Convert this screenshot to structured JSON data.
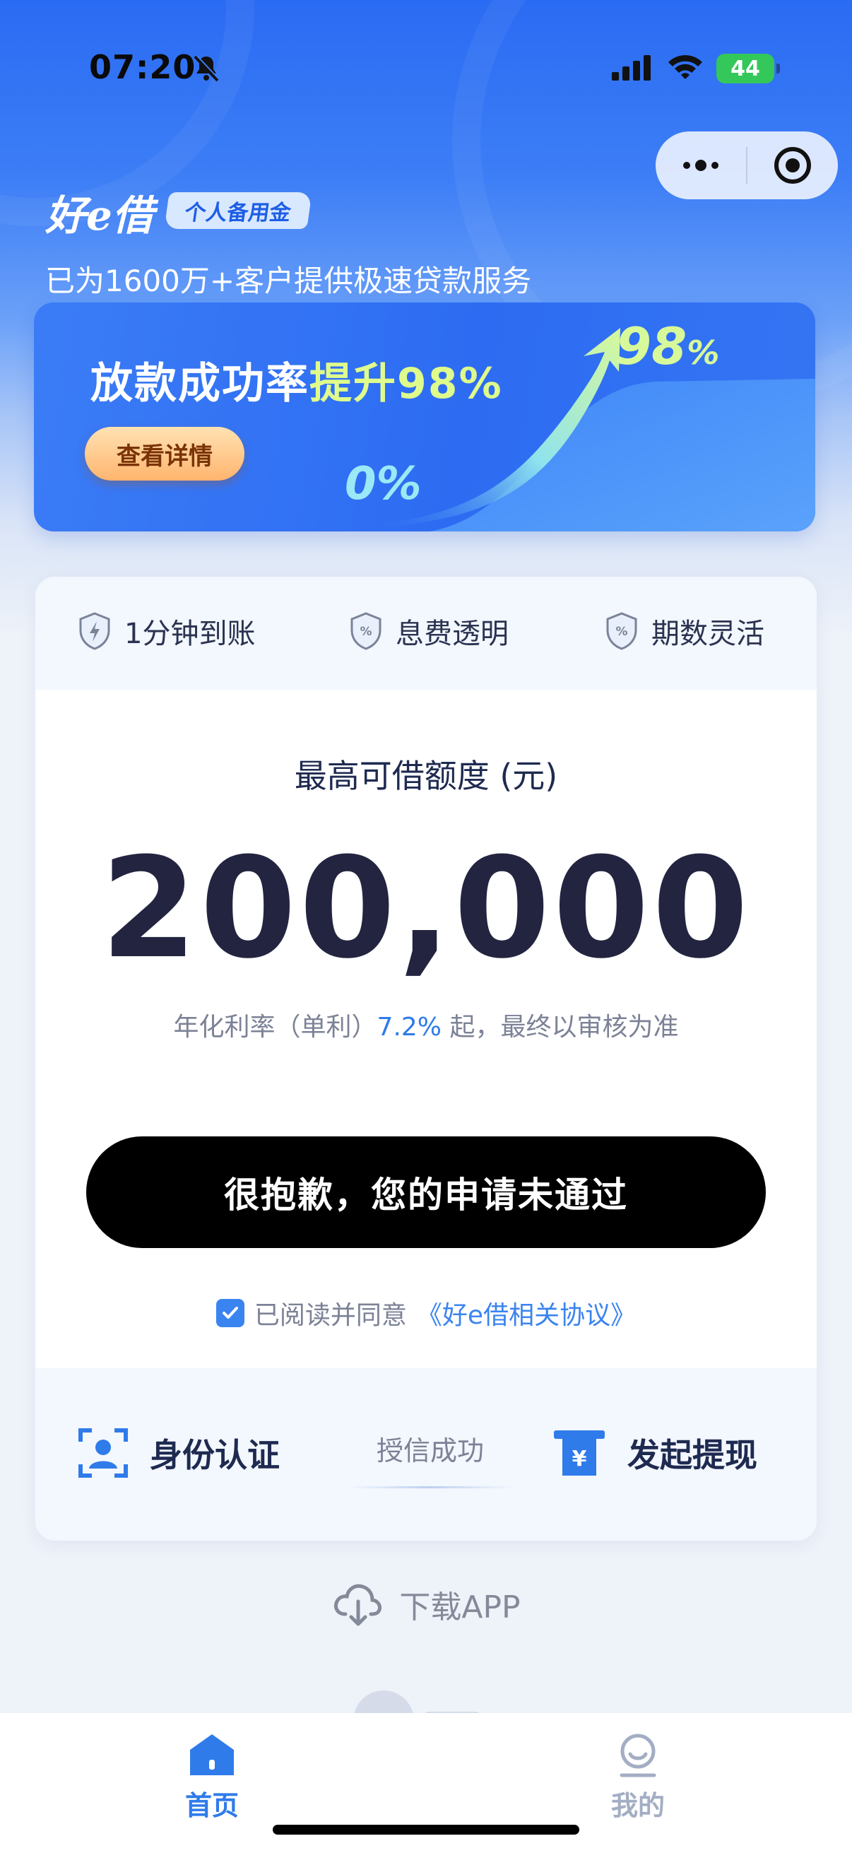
{
  "status_bar": {
    "time": "07:20",
    "battery": "44"
  },
  "header": {
    "logo": "好e借",
    "logo_tag": "个人备用金",
    "tagline": "已为1600万+客户提供极速贷款服务"
  },
  "banner": {
    "headline_prefix": "放款成功率",
    "headline_highlight": "提升98%",
    "button_label": "查看详情",
    "start_value": "0%",
    "end_value": "98",
    "end_unit": "%"
  },
  "features": [
    {
      "label": "1分钟到账",
      "icon": "shield-bolt-icon"
    },
    {
      "label": "息费透明",
      "icon": "shield-percent-icon"
    },
    {
      "label": "期数灵活",
      "icon": "shield-percent-icon"
    }
  ],
  "loan": {
    "title": "最高可借额度 (元)",
    "amount": "200,000",
    "rate_prefix": "年化利率（单利）",
    "rate": "7.2%",
    "rate_suffix": " 起，最终以审核为准",
    "action_label": "很抱歉，您的申请未通过",
    "agree_text": "已阅读并同意",
    "agree_link": "《好e借相关协议》",
    "agreed": true
  },
  "steps": {
    "identity": "身份认证",
    "credit": "授信成功",
    "withdraw": "发起提现"
  },
  "download": {
    "label": "下载APP"
  },
  "tabbar": {
    "home": "首页",
    "mine": "我的",
    "active": "home"
  },
  "colors": {
    "brand_blue": "#2f7bea",
    "hero_blue": "#2a6bf3",
    "highlight_green": "#dffb8b",
    "button_black": "#000000"
  }
}
